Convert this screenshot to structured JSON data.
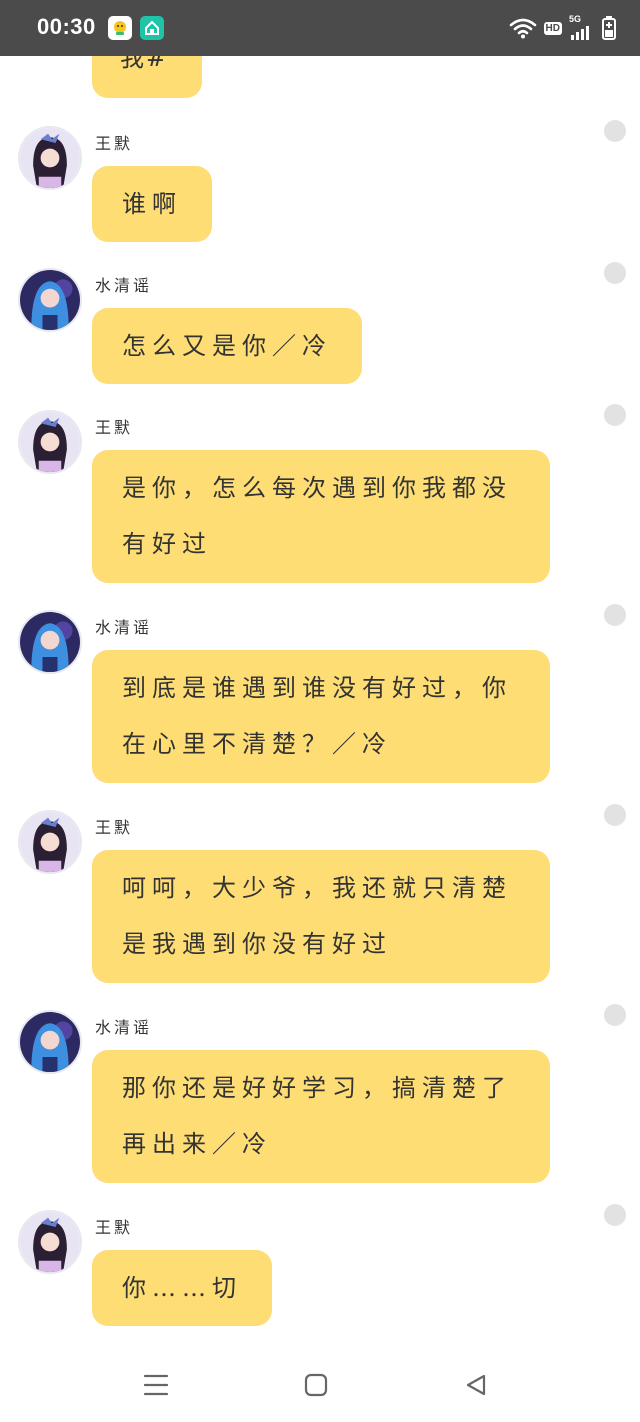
{
  "status_bar": {
    "time": "00:30",
    "hd": "HD",
    "network": "5G"
  },
  "icons": {
    "app_1": "notification-app-icon",
    "app_2": "home-app-icon",
    "wifi": "wifi-icon",
    "signal": "signal-icon",
    "battery": "battery-charging-icon"
  },
  "colors": {
    "bubble": "#fddd74",
    "status_bar": "#4b4b4b",
    "unread_dot": "#e2e2e2"
  },
  "messages": [
    {
      "sender": "",
      "avatar": "",
      "text": "我#"
    },
    {
      "sender": "王默",
      "avatar": "wangmo-avatar",
      "text": "谁啊"
    },
    {
      "sender": "水清谣",
      "avatar": "shuiqingli-avatar",
      "text": "怎么又是你／冷"
    },
    {
      "sender": "王默",
      "avatar": "wangmo-avatar",
      "text": "是你，怎么每次遇到你我都没有好过"
    },
    {
      "sender": "水清谣",
      "avatar": "shuiqingli-avatar",
      "text": "到底是谁遇到谁没有好过，你在心里不清楚？／冷"
    },
    {
      "sender": "王默",
      "avatar": "wangmo-avatar",
      "text": "呵呵，大少爷，我还就只清楚是我遇到你没有好过"
    },
    {
      "sender": "水清谣",
      "avatar": "shuiqingli-avatar",
      "text": "那你还是好好学习，搞清楚了再出来／冷"
    },
    {
      "sender": "王默",
      "avatar": "wangmo-avatar",
      "text": "你……切"
    }
  ],
  "nav": {
    "menu": "menu-icon",
    "home": "home-square-icon",
    "back": "back-triangle-icon"
  }
}
